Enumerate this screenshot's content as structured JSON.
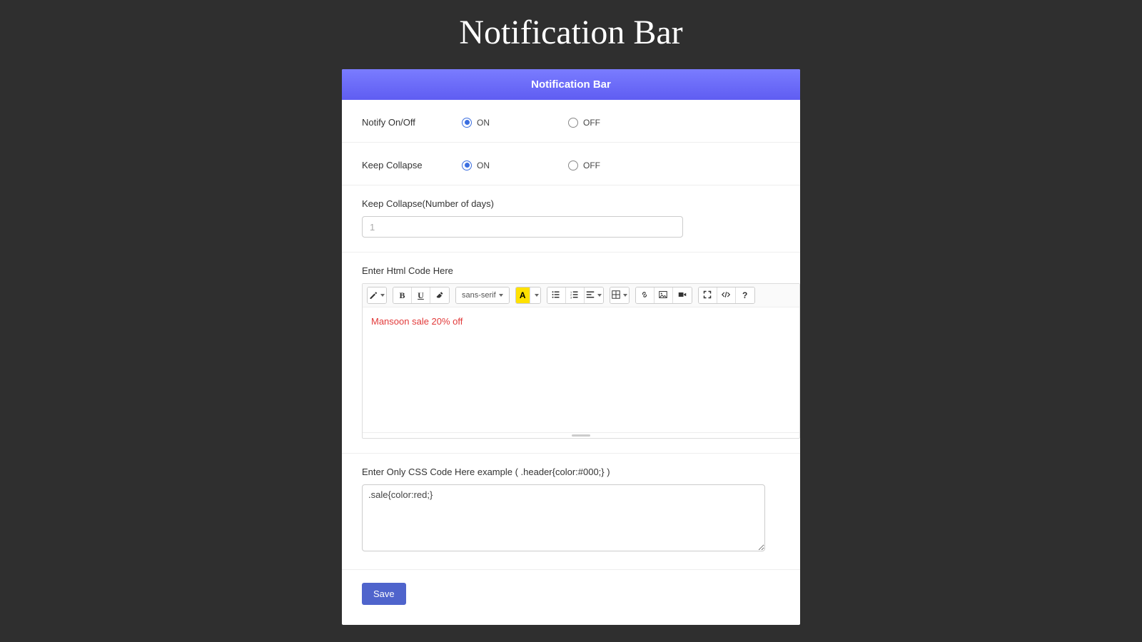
{
  "page": {
    "title": "Notification Bar"
  },
  "panel": {
    "header": "Notification Bar",
    "notify": {
      "label": "Notify On/Off",
      "on_label": "ON",
      "off_label": "OFF",
      "value": "ON"
    },
    "collapse": {
      "label": "Keep Collapse",
      "on_label": "ON",
      "off_label": "OFF",
      "value": "ON"
    },
    "collapse_days": {
      "label": "Keep Collapse(Number of days)",
      "placeholder": "1",
      "value": ""
    },
    "html_editor": {
      "label": "Enter Html Code Here",
      "content": "Mansoon sale 20% off",
      "font_family_label": "sans-serif"
    },
    "css_code": {
      "label": "Enter Only CSS Code Here example ( .header{color:#000;} )",
      "value": ".sale{color:red;}"
    },
    "save_label": "Save"
  }
}
